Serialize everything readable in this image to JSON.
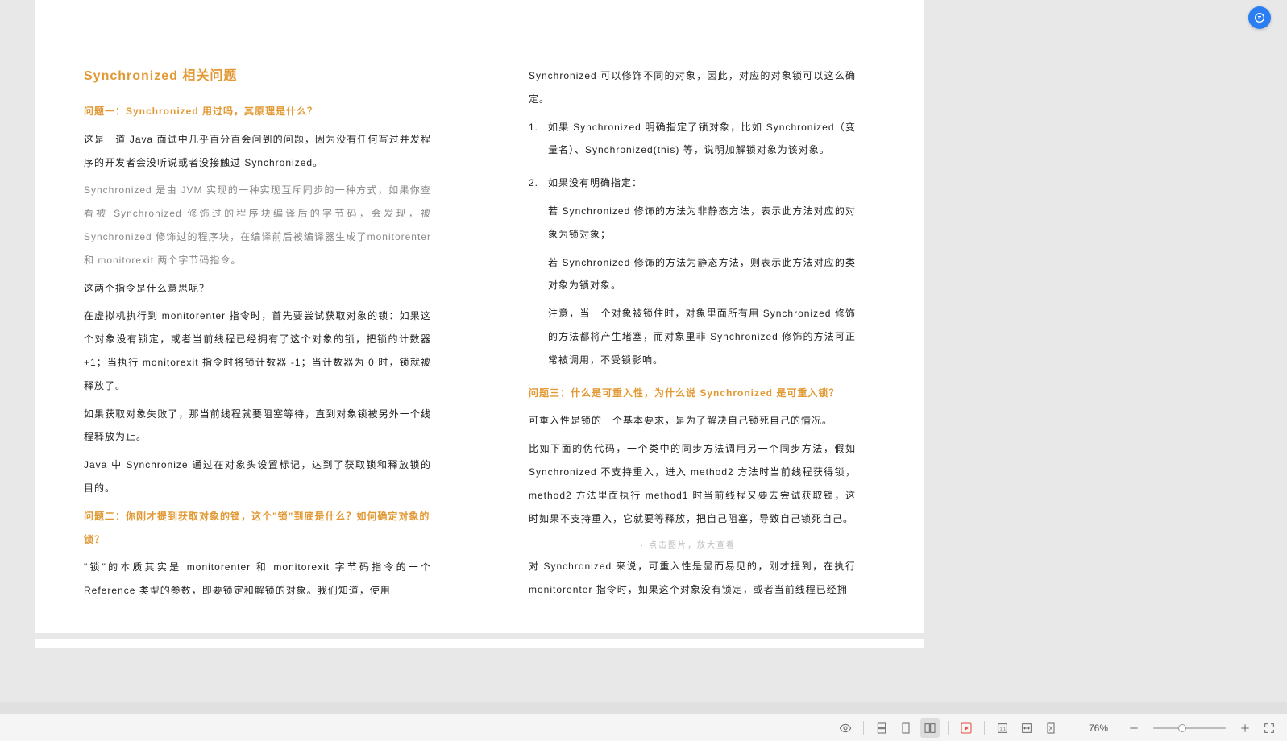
{
  "pageLeft": {
    "title": "Synchronized  相关问题",
    "q1": "问题一：Synchronized  用过吗，其原理是什么？",
    "p1": "这是一道  Java  面试中几乎百分百会问到的问题，因为没有任何写过并发程序的开发者会没听说或者没接触过  Synchronized。",
    "p2": "Synchronized  是由  JVM  实现的一种实现互斥同步的一种方式，如果你查看被  Synchronized  修饰过的程序块编译后的字节码，会发现，被  Synchronized  修饰过的程序块，在编译前后被编译器生成了monitorenter 和  monitorexit  两个字节码指令。",
    "p3": "这两个指令是什么意思呢？",
    "p4": "在虚拟机执行到  monitorenter  指令时，首先要尝试获取对象的锁：如果这个对象没有锁定，或者当前线程已经拥有了这个对象的锁，把锁的计数器  +1；当执行  monitorexit  指令时将锁计数器  -1；当计数器为  0  时，锁就被释放了。",
    "p5": "如果获取对象失败了，那当前线程就要阻塞等待，直到对象锁被另外一个线程释放为止。",
    "p6": "Java  中  Synchronize  通过在对象头设置标记，达到了获取锁和释放锁的目的。",
    "q2": "问题二：你刚才提到获取对象的锁，这个\"锁\"到底是什么？如何确定对象的锁？",
    "p7": "\"锁\"的本质其实是  monitorenter  和  monitorexit  字节码指令的一个  Reference  类型的参数，即要锁定和解锁的对象。我们知道，使用"
  },
  "pageRight": {
    "p1": "Synchronized  可以修饰不同的对象，因此，对应的对象锁可以这么确定。",
    "li1": "如果  Synchronized  明确指定了锁对象，比如  Synchronized（变量名）、Synchronized(this)  等，说明加解锁对象为该对象。",
    "li2label": "如果没有明确指定：",
    "li2a": "若  Synchronized  修饰的方法为非静态方法，表示此方法对应的对象为锁对象；",
    "li2b": "若  Synchronized  修饰的方法为静态方法，则表示此方法对应的类对象为锁对象。",
    "li2c": "注意，当一个对象被锁住时，对象里面所有用  Synchronized  修饰的方法都将产生堵塞，而对象里非  Synchronized  修饰的方法可正常被调用，不受锁影响。",
    "q3": "问题三：什么是可重入性，为什么说  Synchronized  是可重入锁？",
    "p2": "可重入性是锁的一个基本要求，是为了解决自己锁死自己的情况。",
    "p3": "比如下面的伪代码，一个类中的同步方法调用另一个同步方法，假如Synchronized  不支持重入，进入  method2  方法时当前线程获得锁，method2  方法里面执行  method1  时当前线程又要去尝试获取锁，这时如果不支持重入，它就要等释放，把自己阻塞，导致自己锁死自己。",
    "note": "·  点击图片，放大查看  ·",
    "p4": "对  Synchronized  来说，可重入性是显而易见的，刚才提到，在执行monitorenter  指令时，如果这个对象没有锁定，或者当前线程已经拥"
  },
  "list": {
    "n1": "1.",
    "n2": "2."
  },
  "toolbar": {
    "zoom": "76%"
  }
}
